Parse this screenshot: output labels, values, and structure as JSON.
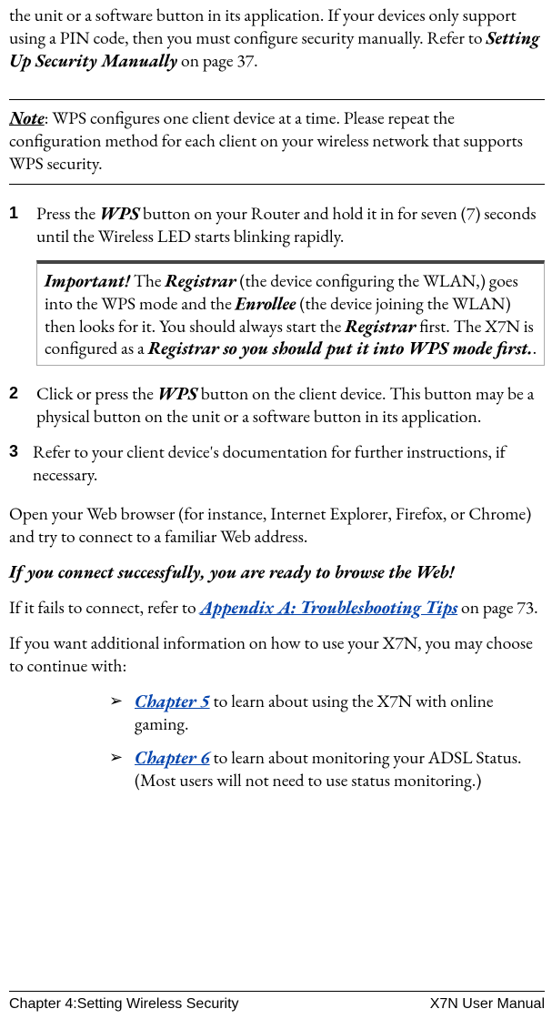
{
  "intro": {
    "prefix": "the unit or a software button in its application. If your devices only support using a PIN code, then you must configure security manually. Refer to ",
    "ref": "Setting Up Security Manually",
    "suffix": " on page 37."
  },
  "note": {
    "label": "Note",
    "text": ": WPS configures one client device at a time. Please repeat the configuration method for each client on your wireless network that supports WPS security."
  },
  "steps": {
    "s1": {
      "num": "1",
      "t1": "Press the ",
      "wps": "WPS",
      "t2": " button on your Router and hold it in for seven (7) seconds until the Wireless LED starts blinking rapidly."
    },
    "important": {
      "label": "Important!",
      "t1": " The ",
      "registrar": "Registrar",
      "t2": " (the device configuring the WLAN,) goes into the WPS mode and the ",
      "enrollee": "Enrollee",
      "t3": " (the device joining the WLAN) then looks for it. You should always start the ",
      "t4": " first. The X7N is configured as a ",
      "phrase": "Registrar so you should put it into WPS mode first.",
      "period": "."
    },
    "s2": {
      "num": "2",
      "t1": "Click or press the ",
      "wps": "WPS",
      "t2": " button on the client device.  This button may be a physical button on the unit or a software button in its application."
    },
    "s3": {
      "num": "3",
      "t1": "Refer to your client device's documentation for further instructions, if necessary."
    }
  },
  "open_browser": "Open your Web browser (for instance, Internet Explorer, Firefox, or Chrome) and try to connect to a familiar Web address.",
  "success_line": "If you connect successfully, you are ready to browse the Web!",
  "fails": {
    "t1": "If it fails to connect, refer to ",
    "link": "Appendix A: Troubleshooting Tips",
    "t2": " on page 73."
  },
  "additional_info": "If you want additional information on how to use your X7N, you may choose to continue with:",
  "bullets": {
    "b1": {
      "link": "Chapter 5",
      "text": " to learn about using the X7N with online gaming."
    },
    "b2": {
      "link": "Chapter 6",
      "text": " to learn about monitoring your ADSL Status. (Most users will not need to use status monitoring.)"
    }
  },
  "footer": {
    "left": "Chapter 4:Setting Wireless Security",
    "right": "X7N User Manual"
  },
  "glyphs": {
    "arrow": "➢"
  }
}
